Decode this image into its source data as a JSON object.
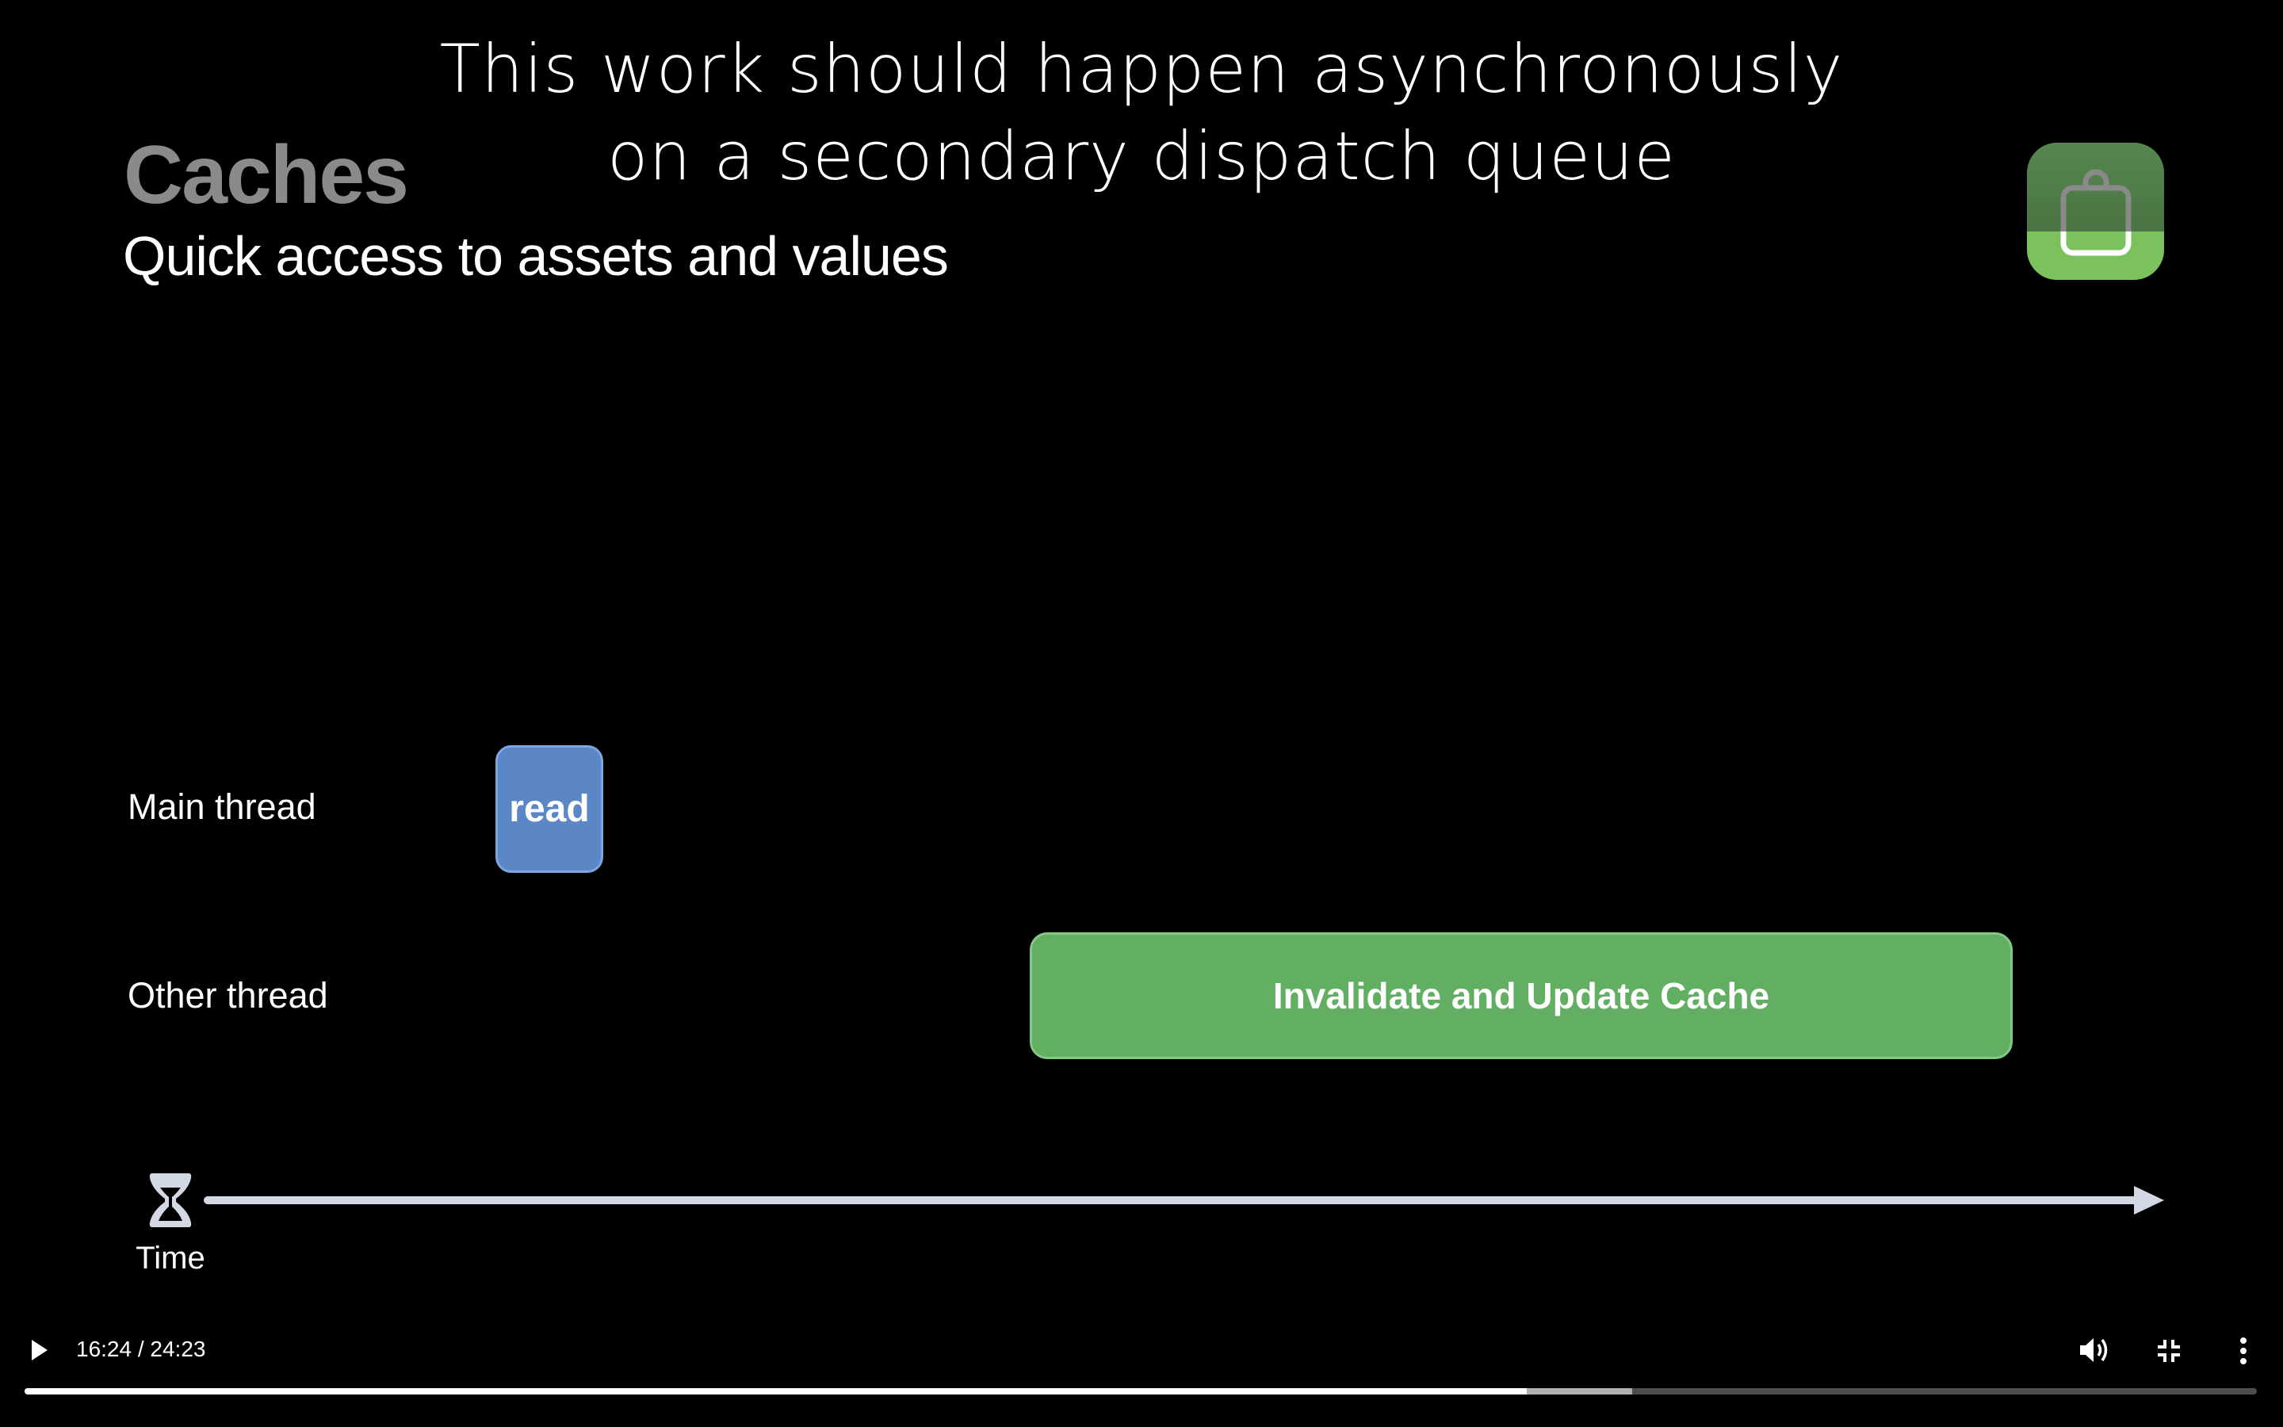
{
  "caption": {
    "line1": "This work should happen asynchronously",
    "line2": "on a secondary dispatch queue"
  },
  "slide": {
    "title": "Caches",
    "subtitle": "Quick access to assets and values",
    "app_icon": "shopping-bag-icon",
    "rows": {
      "main": "Main thread",
      "other": "Other thread"
    },
    "blocks": {
      "read": "read",
      "cache": "Invalidate and Update Cache"
    },
    "time_label": "Time",
    "colors": {
      "read": "#5b87c7",
      "cache": "#62ae62",
      "title": "#8a8a8a"
    }
  },
  "player": {
    "time_display": "16:24 / 24:23",
    "played_fraction": 0.673,
    "buffered_fraction": 0.72,
    "icons": [
      "play-icon",
      "volume-icon",
      "exit-fullscreen-icon",
      "more-options-icon"
    ]
  }
}
